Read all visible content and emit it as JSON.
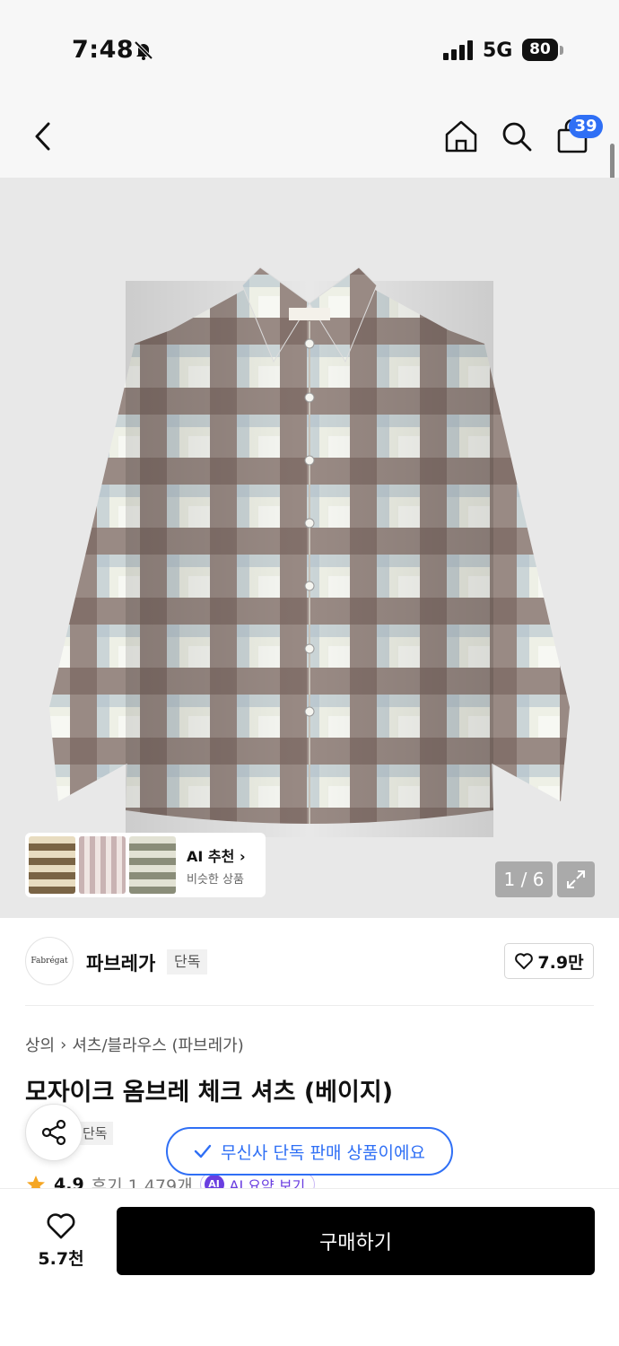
{
  "status_bar": {
    "time": "7:48",
    "network": "5G",
    "battery": "80"
  },
  "nav": {
    "cart_count": "39"
  },
  "hero": {
    "image_counter": "1 / 6",
    "ai_recommend": {
      "title": "AI 추천",
      "subtitle": "비슷한 상품"
    }
  },
  "brand": {
    "logo_text": "Fabrégat",
    "name": "파브레가",
    "tag": "단독",
    "likes": "7.9만"
  },
  "product": {
    "breadcrumb": [
      "상의",
      "셔츠/블라우스 (파브레가)"
    ],
    "title": "모자이크 옴브레 체크 셔츠 (베이지)",
    "tag": "단독",
    "rating": "4.9",
    "reviews": "후기 1,479개",
    "ai_summary": "AI 요약 보기",
    "ai_badge": "AI"
  },
  "toast": {
    "text": "무신사 단독 판매 상품이에요"
  },
  "bottom_bar": {
    "wish_count": "5.7천",
    "buy_label": "구매하기"
  },
  "colors": {
    "accent": "#2f6ff5",
    "ai": "#6a3ee0",
    "star": "#f5a623",
    "buy_button": "#000000"
  },
  "icons": [
    "bell-slash-icon",
    "signal-icon",
    "back-chevron-icon",
    "home-icon",
    "search-icon",
    "cart-bag-icon",
    "expand-icon",
    "heart-icon",
    "share-icon",
    "check-icon",
    "star-icon",
    "chevron-right-icon"
  ]
}
